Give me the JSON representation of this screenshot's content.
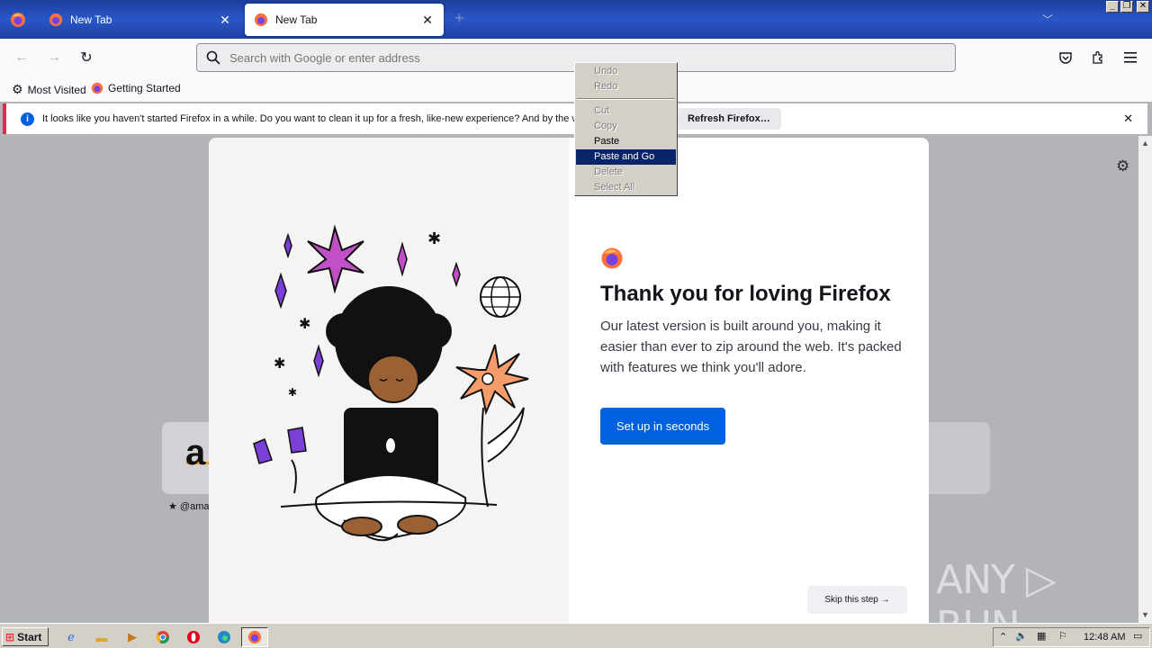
{
  "window": {
    "minimize_glyph": "_",
    "restore_glyph": "❐",
    "close_glyph": "✕"
  },
  "tabs": [
    {
      "label": "New Tab",
      "active": false
    },
    {
      "label": "New Tab",
      "active": true
    }
  ],
  "navbar": {
    "back_icon": "←",
    "forward_icon": "→",
    "reload_icon": "↻",
    "url_placeholder": "Search with Google or enter address"
  },
  "bookmarks": [
    {
      "label": "Most Visited",
      "icon": "gear-icon"
    },
    {
      "label": "Getting Started",
      "icon": "firefox-icon"
    }
  ],
  "notification": {
    "message": "It looks like you haven't started Firefox in a while. Do you want to clean it up for a fresh, like-new experience? And by the way, welcome back!",
    "button": "Refresh Firefox…"
  },
  "context_menu": {
    "items": [
      {
        "label": "Undo",
        "enabled": false
      },
      {
        "label": "Redo",
        "enabled": false
      },
      {
        "label": "Cut",
        "enabled": false
      },
      {
        "label": "Copy",
        "enabled": false
      },
      {
        "label": "Paste",
        "enabled": true
      },
      {
        "label": "Paste and Go",
        "enabled": true,
        "highlighted": true
      },
      {
        "label": "Delete",
        "enabled": false
      },
      {
        "label": "Select All",
        "enabled": false
      }
    ]
  },
  "newtab": {
    "shortcut_label": "★ @ama"
  },
  "modal": {
    "title": "Thank you for loving Firefox",
    "subtitle": "Our latest version is built around you, making it easier than ever to zip around the web. It's packed with features we think you'll adore.",
    "primary_button": "Set up in seconds",
    "skip_button": "Skip this step →"
  },
  "watermark": "ANY ▷ RUN",
  "taskbar": {
    "start_label": "Start",
    "clock": "12:48 AM"
  },
  "colors": {
    "accent": "#0061e0",
    "titlebar": "#2a57c8",
    "menu_highlight": "#0a246a",
    "notification_border": "#e22850"
  }
}
